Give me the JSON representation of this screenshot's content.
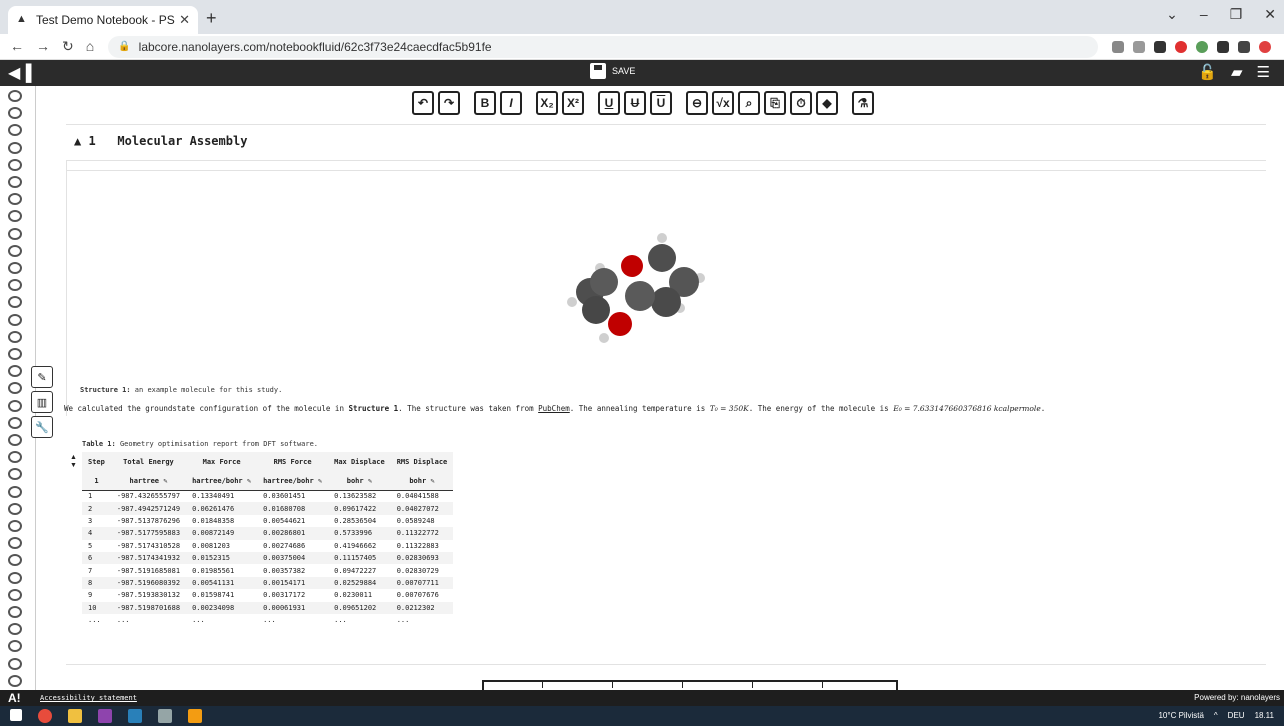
{
  "browser": {
    "tab_title": "Test Demo Notebook - PS",
    "new_tab": "+",
    "url": "labcore.nanolayers.com/notebookfluid/62c3f73e24caecdfac5b91fe"
  },
  "appbar": {
    "save_label": "SAVE"
  },
  "section": {
    "number": "1",
    "title": "Molecular Assembly"
  },
  "figure": {
    "caption_label": "Structure 1:",
    "caption_text": "an example molecule for this study."
  },
  "body": {
    "p1": "We calculated the groundstate configuration of the molecule in ",
    "p1_ref": "Structure 1",
    "p2": ". The structure was taken from ",
    "p2_link": "PubChem",
    "p3": ". The annealing temperature is ",
    "p3_math": "T₀ = 350K",
    "p4": ". The energy of the molecule is ",
    "p4_math": "E₀ = 7.633147660376816 kcalpermole",
    "p5": "."
  },
  "table": {
    "caption_label": "Table 1:",
    "caption_text": "Geometry optimisation report from DFT software.",
    "headers": [
      "Step",
      "Total Energy",
      "Max Force",
      "RMS Force",
      "Max Displace",
      "RMS Displace"
    ],
    "units": [
      "1",
      "hartree ✎",
      "hartree/bohr ✎",
      "hartree/bohr ✎",
      "bohr ✎",
      "bohr ✎"
    ],
    "rows": [
      [
        "1",
        "-987.4326555797",
        "0.13340491",
        "0.03601451",
        "0.13623582",
        "0.04041588"
      ],
      [
        "2",
        "-987.4942571249",
        "0.06261476",
        "0.01680708",
        "0.09617422",
        "0.04027072"
      ],
      [
        "3",
        "-987.5137876296",
        "0.01848358",
        "0.00544621",
        "0.28536504",
        "0.0589248"
      ],
      [
        "4",
        "-987.5177595883",
        "0.00872149",
        "0.00286801",
        "0.5733996",
        "0.11322772"
      ],
      [
        "5",
        "-987.5174310528",
        "0.0081203",
        "0.00274686",
        "0.41946662",
        "0.11322883"
      ],
      [
        "6",
        "-987.5174341932",
        "0.0152315",
        "0.00375004",
        "0.11157405",
        "0.02830693"
      ],
      [
        "7",
        "-987.5191685081",
        "0.01985561",
        "0.00357382",
        "0.09472227",
        "0.02830729"
      ],
      [
        "8",
        "-987.5196080392",
        "0.00541131",
        "0.00154171",
        "0.02529884",
        "0.00707711"
      ],
      [
        "9",
        "-987.5193830132",
        "0.01598741",
        "0.00317172",
        "0.0230011",
        "0.00707676"
      ],
      [
        "10",
        "-987.5198701688",
        "0.00234098",
        "0.00061931",
        "0.09651202",
        "0.0212302"
      ],
      [
        "...",
        "...",
        "...",
        "...",
        "...",
        "..."
      ]
    ]
  },
  "footer": {
    "a11y_logo": "A!",
    "a11y_text": "Accessibility statement",
    "powered": "Powered by: nanolayers"
  },
  "taskbar": {
    "weather": "10°C Pilvistä",
    "lang": "DEU",
    "time": "18.11"
  },
  "colors": {
    "appbar_bg": "#2b2b2b",
    "carbon": "#4a4a4a",
    "oxygen": "#c00000",
    "hydrogen": "#d0d0d0"
  }
}
